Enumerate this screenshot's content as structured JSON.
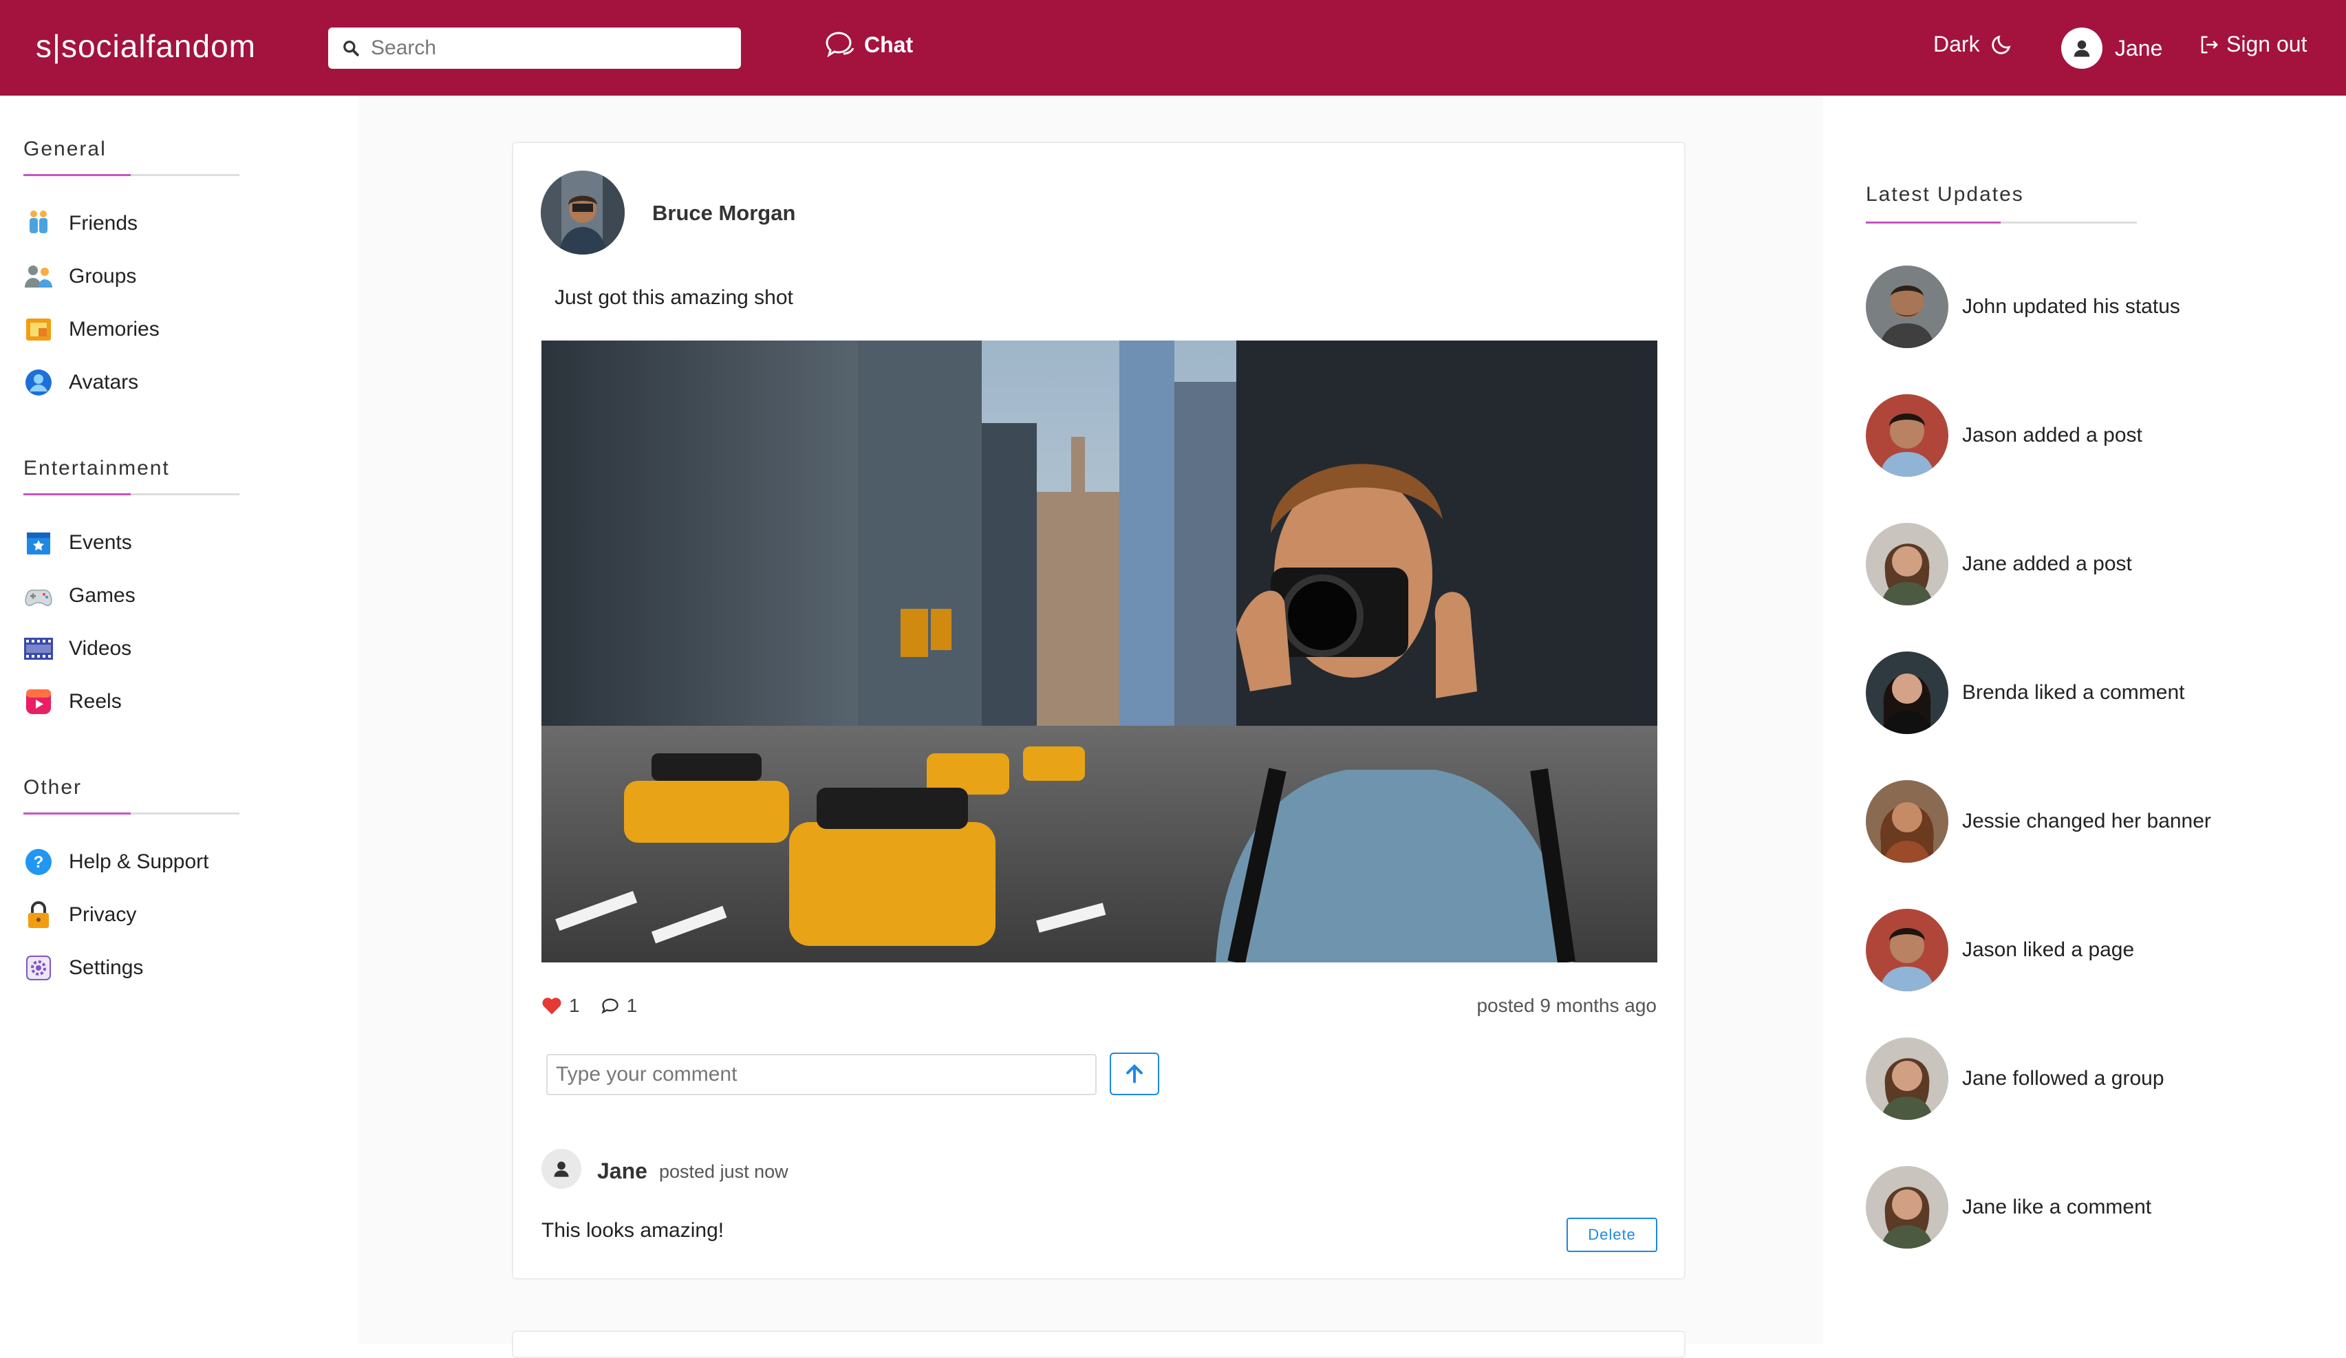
{
  "header": {
    "logo": "s|socialfandom",
    "search_placeholder": "Search",
    "chat": "Chat",
    "theme": "Dark",
    "user": "Jane",
    "signout": "Sign out"
  },
  "colors": {
    "brand": "#a3133e",
    "accent": "#c754c4",
    "link": "#1e88e5"
  },
  "sidebar": {
    "general": {
      "title": "General",
      "items": [
        {
          "label": "Friends",
          "icon": "friends-icon"
        },
        {
          "label": "Groups",
          "icon": "groups-icon"
        },
        {
          "label": "Memories",
          "icon": "memories-icon"
        },
        {
          "label": "Avatars",
          "icon": "avatars-icon"
        }
      ]
    },
    "entertainment": {
      "title": "Entertainment",
      "items": [
        {
          "label": "Events",
          "icon": "events-icon"
        },
        {
          "label": "Games",
          "icon": "games-icon"
        },
        {
          "label": "Videos",
          "icon": "videos-icon"
        },
        {
          "label": "Reels",
          "icon": "reels-icon"
        }
      ]
    },
    "other": {
      "title": "Other",
      "items": [
        {
          "label": "Help & Support",
          "icon": "help-icon"
        },
        {
          "label": "Privacy",
          "icon": "lock-icon"
        },
        {
          "label": "Settings",
          "icon": "settings-icon"
        }
      ]
    }
  },
  "post": {
    "author": "Bruce Morgan",
    "text": "Just got this amazing shot",
    "likes": "1",
    "comments": "1",
    "posted": "posted 9 months ago",
    "comment_placeholder": "Type your comment",
    "comment": {
      "author": "Jane",
      "time": "posted just now",
      "text": "This looks amazing!",
      "delete": "Delete"
    }
  },
  "updates": {
    "title": "Latest Updates",
    "items": [
      "John updated his status",
      "Jason added a post",
      "Jane added a post",
      "Brenda liked a comment",
      "Jessie changed her banner",
      "Jason liked a page",
      "Jane followed a group",
      "Jane like a comment"
    ]
  }
}
